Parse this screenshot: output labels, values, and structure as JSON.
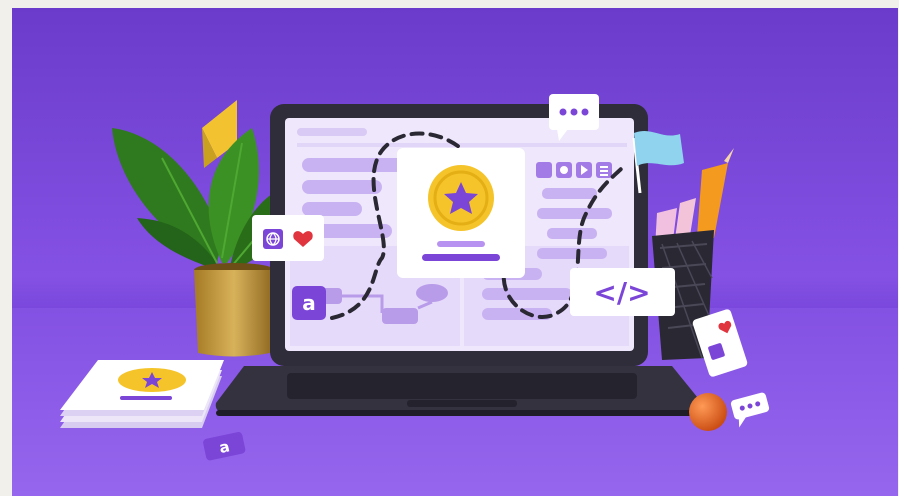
{
  "scene": {
    "colors": {
      "page_border": "#f1f0ea",
      "bg_top": "#6f3fcf",
      "bg_mid": "#8552e6",
      "floor": "#9a6cf0",
      "laptop_body": "#2f2d3a",
      "screen_bg": "#efe7fb",
      "screen_block": "#c9b2f2",
      "accent_purple": "#7b45d8",
      "star_yellow": "#f5c42a",
      "heart_red": "#e0353f",
      "card_white": "#ffffff",
      "flag_blue": "#8fd3ef",
      "pencil_orange": "#f39a1f",
      "ball_orange": "#e4611d",
      "plant_green": "#2f7a1e",
      "pot_gold": "#c39a3a"
    },
    "glyphs": {
      "letter_tile": "a",
      "code_tag": "</>"
    },
    "icons": [
      "laptop-icon",
      "star-badge-icon",
      "globe-icon",
      "heart-icon",
      "code-tag-icon",
      "chat-bubble-icon",
      "flag-icon",
      "plant-icon",
      "pencil-cup-icon",
      "ball-icon",
      "card-stack-icon",
      "letter-tile-icon"
    ]
  }
}
